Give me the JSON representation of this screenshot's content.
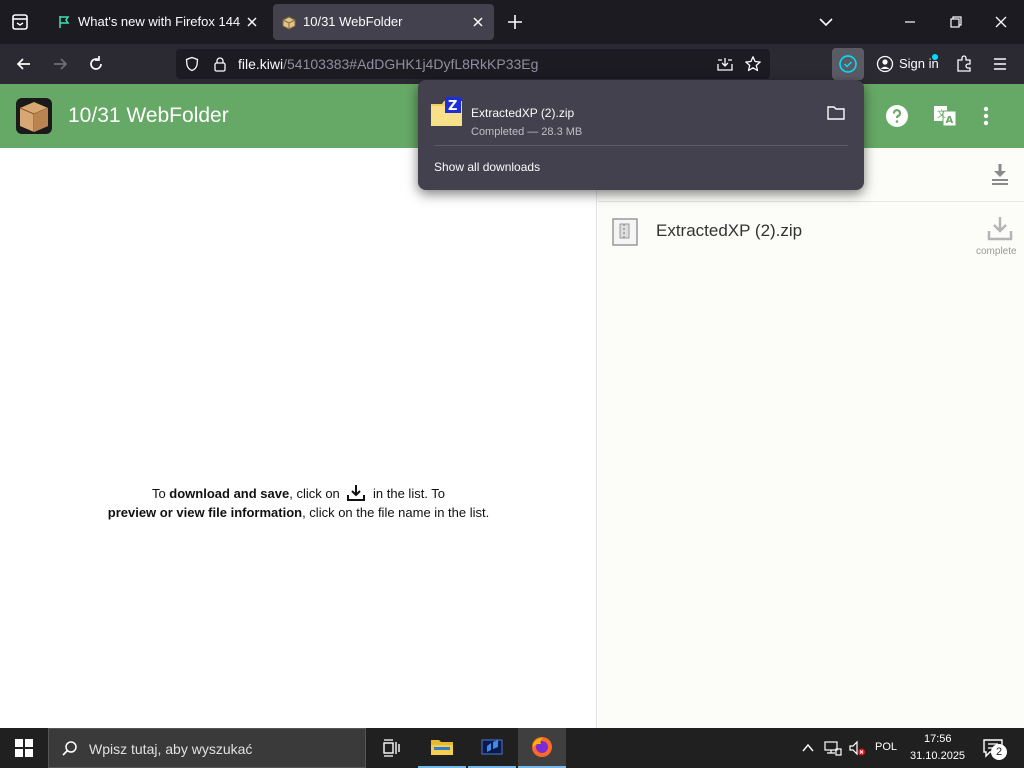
{
  "browser": {
    "tabs": [
      {
        "title": "What's new with Firefox 144"
      },
      {
        "title": "10/31 WebFolder"
      }
    ],
    "url": {
      "host": "file.kiwi",
      "path": "/54103383#AdDGHK1j4DyfL8RkKP33Eg"
    },
    "signin_label": "Sign in"
  },
  "app": {
    "title": "10/31 WebFolder",
    "instructions": {
      "line1_pre": "To ",
      "line1_bold": "download and save",
      "line1_mid": ", click on ",
      "line1_post": " in the list. To",
      "line2_bold": "preview or view file information",
      "line2_post": ", click on the file name in the list."
    },
    "files": [
      {
        "name": "ExtractedXP (2).zip",
        "status": "complete"
      }
    ]
  },
  "downloads_panel": {
    "file_name": "ExtractedXP (2).zip",
    "status": "Completed — 28.3 MB",
    "show_all_label": "Show all downloads"
  },
  "taskbar": {
    "search_placeholder": "Wpisz tutaj, aby wyszukać",
    "lang": "POL",
    "time": "17:56",
    "date": "31.10.2025",
    "notification_count": "2"
  },
  "colors": {
    "appbar_green": "#66a866",
    "accent_blue": "#0060df"
  }
}
